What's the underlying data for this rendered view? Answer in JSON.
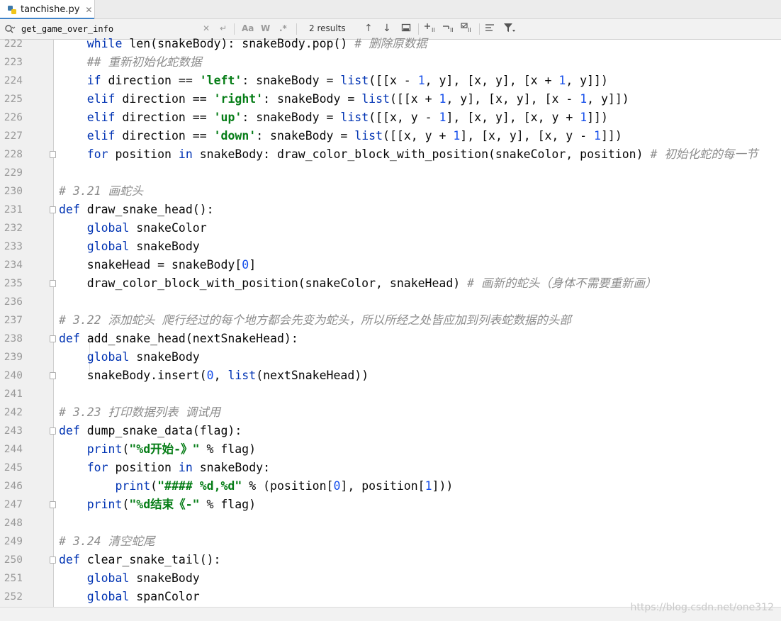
{
  "tab": {
    "filename": "tanchishe.py",
    "close_glyph": "✕"
  },
  "search": {
    "query": "get_game_over_info",
    "results": "2 results",
    "match_case_label": "Aa",
    "whole_word_label": "W",
    "regex_label": ".*"
  },
  "code_lines": [
    {
      "n": "222",
      "segments": [
        [
          "    ",
          ""
        ],
        [
          "while",
          "kw"
        ],
        [
          " len(snakeBody): snakeBody.pop() ",
          ""
        ],
        [
          "# 删除原数据",
          "cm"
        ]
      ]
    },
    {
      "n": "223",
      "segments": [
        [
          "    ",
          ""
        ],
        [
          "## 重新初始化蛇数据",
          "cm"
        ]
      ]
    },
    {
      "n": "224",
      "segments": [
        [
          "    ",
          ""
        ],
        [
          "if",
          "kw"
        ],
        [
          " direction == ",
          ""
        ],
        [
          "'left'",
          "str"
        ],
        [
          ": snakeBody = ",
          ""
        ],
        [
          "list",
          "kw"
        ],
        [
          "([[x - ",
          ""
        ],
        [
          "1",
          "num"
        ],
        [
          ", y], [x, y], [x + ",
          ""
        ],
        [
          "1",
          "num"
        ],
        [
          ", y]])",
          ""
        ]
      ]
    },
    {
      "n": "225",
      "segments": [
        [
          "    ",
          ""
        ],
        [
          "elif",
          "kw"
        ],
        [
          " direction == ",
          ""
        ],
        [
          "'right'",
          "str"
        ],
        [
          ": snakeBody = ",
          ""
        ],
        [
          "list",
          "kw"
        ],
        [
          "([[x + ",
          ""
        ],
        [
          "1",
          "num"
        ],
        [
          ", y], [x, y], [x - ",
          ""
        ],
        [
          "1",
          "num"
        ],
        [
          ", y]])",
          ""
        ]
      ]
    },
    {
      "n": "226",
      "segments": [
        [
          "    ",
          ""
        ],
        [
          "elif",
          "kw"
        ],
        [
          " direction == ",
          ""
        ],
        [
          "'up'",
          "str"
        ],
        [
          ": snakeBody = ",
          ""
        ],
        [
          "list",
          "kw"
        ],
        [
          "([[x, y - ",
          ""
        ],
        [
          "1",
          "num"
        ],
        [
          "], [x, y], [x, y + ",
          ""
        ],
        [
          "1",
          "num"
        ],
        [
          "]])",
          ""
        ]
      ]
    },
    {
      "n": "227",
      "segments": [
        [
          "    ",
          ""
        ],
        [
          "elif",
          "kw"
        ],
        [
          " direction == ",
          ""
        ],
        [
          "'down'",
          "str"
        ],
        [
          ": snakeBody = ",
          ""
        ],
        [
          "list",
          "kw"
        ],
        [
          "([[x, y + ",
          ""
        ],
        [
          "1",
          "num"
        ],
        [
          "], [x, y], [x, y - ",
          ""
        ],
        [
          "1",
          "num"
        ],
        [
          "]])",
          ""
        ]
      ]
    },
    {
      "n": "228",
      "segments": [
        [
          "    ",
          ""
        ],
        [
          "for",
          "kw"
        ],
        [
          " position ",
          ""
        ],
        [
          "in",
          "kw"
        ],
        [
          " snakeBody: draw_color_block_with_position(snakeColor, position) ",
          ""
        ],
        [
          "# 初始化蛇的每一节",
          "cm"
        ]
      ],
      "fold": true
    },
    {
      "n": "229",
      "segments": []
    },
    {
      "n": "230",
      "segments": [
        [
          "# 3.21 画蛇头",
          "cm"
        ]
      ]
    },
    {
      "n": "231",
      "segments": [
        [
          "def",
          "kw"
        ],
        [
          " draw_snake_head():",
          ""
        ]
      ],
      "fold": true
    },
    {
      "n": "232",
      "segments": [
        [
          "    ",
          ""
        ],
        [
          "global",
          "kw"
        ],
        [
          " snakeColor",
          ""
        ]
      ]
    },
    {
      "n": "233",
      "segments": [
        [
          "    ",
          ""
        ],
        [
          "global",
          "kw"
        ],
        [
          " snakeBody",
          ""
        ]
      ]
    },
    {
      "n": "234",
      "segments": [
        [
          "    snakeHead = snakeBody[",
          ""
        ],
        [
          "0",
          "num"
        ],
        [
          "]",
          ""
        ]
      ]
    },
    {
      "n": "235",
      "segments": [
        [
          "    draw_color_block_with_position(snakeColor, snakeHead) ",
          ""
        ],
        [
          "# 画新的蛇头（身体不需要重新画）",
          "cm"
        ]
      ],
      "fold": true
    },
    {
      "n": "236",
      "segments": []
    },
    {
      "n": "237",
      "segments": [
        [
          "# 3.22 添加蛇头 爬行经过的每个地方都会先变为蛇头，所以所经之处皆应加到列表蛇数据的头部",
          "cm"
        ]
      ]
    },
    {
      "n": "238",
      "segments": [
        [
          "def",
          "kw"
        ],
        [
          " add_snake_head(nextSnakeHead):",
          ""
        ]
      ],
      "fold": true
    },
    {
      "n": "239",
      "segments": [
        [
          "    ",
          ""
        ],
        [
          "global",
          "kw"
        ],
        [
          " snakeBody",
          ""
        ]
      ]
    },
    {
      "n": "240",
      "segments": [
        [
          "    snakeBody.insert(",
          ""
        ],
        [
          "0",
          "num"
        ],
        [
          ", ",
          ""
        ],
        [
          "list",
          "kw"
        ],
        [
          "(nextSnakeHead))",
          ""
        ]
      ],
      "fold": true
    },
    {
      "n": "241",
      "segments": []
    },
    {
      "n": "242",
      "segments": [
        [
          "# 3.23 打印数据列表 调试用",
          "cm"
        ]
      ]
    },
    {
      "n": "243",
      "segments": [
        [
          "def",
          "kw"
        ],
        [
          " dump_snake_data(flag):",
          ""
        ]
      ],
      "fold": true
    },
    {
      "n": "244",
      "segments": [
        [
          "    ",
          ""
        ],
        [
          "print",
          "kw"
        ],
        [
          "(",
          ""
        ],
        [
          "\"%d开始-》\"",
          "str"
        ],
        [
          " % flag)",
          ""
        ]
      ]
    },
    {
      "n": "245",
      "segments": [
        [
          "    ",
          ""
        ],
        [
          "for",
          "kw"
        ],
        [
          " position ",
          ""
        ],
        [
          "in",
          "kw"
        ],
        [
          " snakeBody:",
          ""
        ]
      ]
    },
    {
      "n": "246",
      "segments": [
        [
          "        ",
          ""
        ],
        [
          "print",
          "kw"
        ],
        [
          "(",
          ""
        ],
        [
          "\"#### %d,%d\"",
          "str"
        ],
        [
          " % (position[",
          ""
        ],
        [
          "0",
          "num"
        ],
        [
          "], position[",
          ""
        ],
        [
          "1",
          "num"
        ],
        [
          "]))",
          ""
        ]
      ]
    },
    {
      "n": "247",
      "segments": [
        [
          "    ",
          ""
        ],
        [
          "print",
          "kw"
        ],
        [
          "(",
          ""
        ],
        [
          "\"%d结束《-\"",
          "str"
        ],
        [
          " % flag)",
          ""
        ]
      ],
      "fold": true
    },
    {
      "n": "248",
      "segments": []
    },
    {
      "n": "249",
      "segments": [
        [
          "# 3.24 清空蛇尾",
          "cm"
        ]
      ]
    },
    {
      "n": "250",
      "segments": [
        [
          "def",
          "kw"
        ],
        [
          " clear_snake_tail():",
          ""
        ]
      ],
      "fold": true
    },
    {
      "n": "251",
      "segments": [
        [
          "    ",
          ""
        ],
        [
          "global",
          "kw"
        ],
        [
          " snakeBody",
          ""
        ]
      ]
    },
    {
      "n": "252",
      "segments": [
        [
          "    ",
          ""
        ],
        [
          "global",
          "kw"
        ],
        [
          " spanColor",
          ""
        ]
      ]
    }
  ],
  "watermark": "https://blog.csdn.net/one312",
  "colors": {
    "keyword": "#0033b3",
    "string": "#067d17",
    "number": "#1750eb",
    "comment": "#8c8c8c",
    "tab_accent": "#4083c9"
  }
}
